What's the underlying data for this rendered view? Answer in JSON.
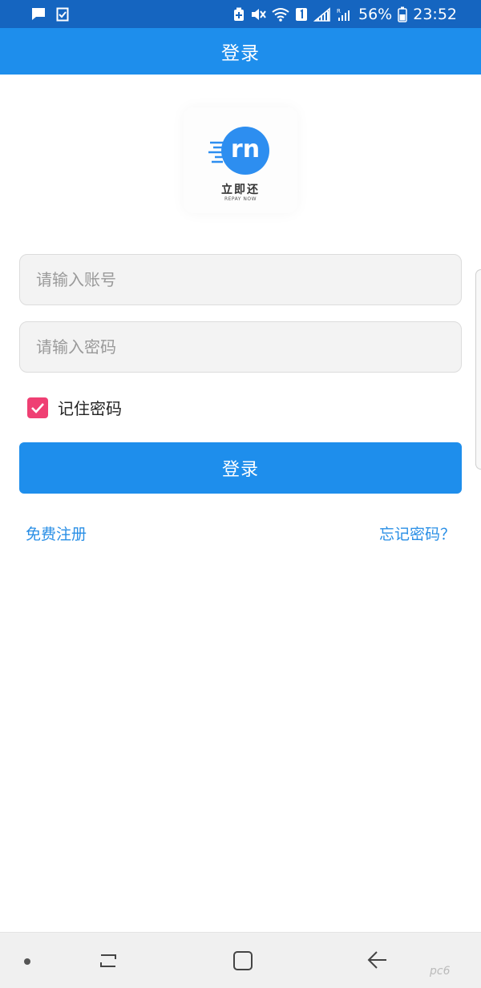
{
  "status_bar": {
    "battery_percent": "56%",
    "time": "23:52"
  },
  "header": {
    "title": "登录"
  },
  "logo": {
    "mark_text": "rn",
    "cn_name": "立即还",
    "en_name": "REPAY NOW"
  },
  "form": {
    "account_placeholder": "请输入账号",
    "account_value": "",
    "password_placeholder": "请输入密码",
    "password_value": "",
    "remember_label": "记住密码",
    "remember_checked": true,
    "login_label": "登录"
  },
  "links": {
    "register": "免费注册",
    "forgot": "忘记密码？"
  },
  "watermark": "pc6",
  "colors": {
    "status_bar": "#1565c0",
    "header": "#1e8eec",
    "accent": "#1e8eec",
    "checkbox": "#ef3f73",
    "link": "#2a8fe6"
  }
}
